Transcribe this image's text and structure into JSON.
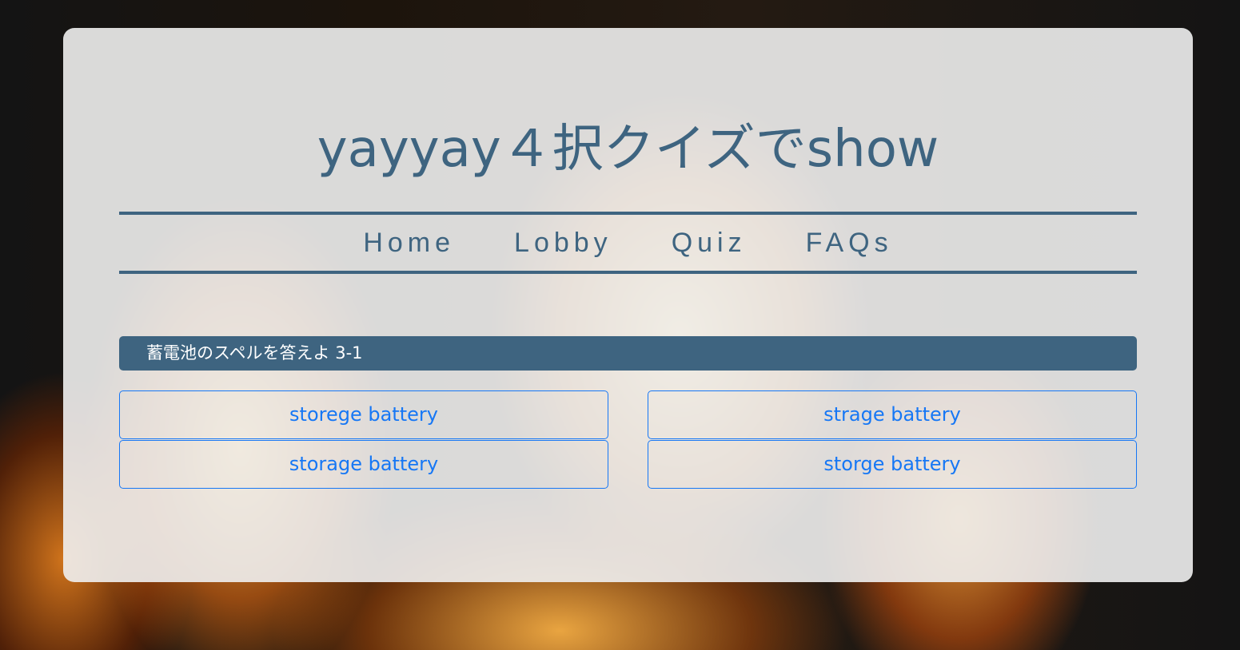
{
  "page": {
    "title": "yayyay４択クイズでshow"
  },
  "nav": {
    "items": [
      {
        "label": "Home"
      },
      {
        "label": "Lobby"
      },
      {
        "label": "Quiz"
      },
      {
        "label": "FAQs"
      }
    ]
  },
  "quiz": {
    "question": "蓄電池のスペルを答えよ 3-1",
    "answers": [
      {
        "label": "storege battery"
      },
      {
        "label": "strage battery"
      },
      {
        "label": "storage battery"
      },
      {
        "label": "storge battery"
      }
    ]
  },
  "colors": {
    "primary": "#3e6480",
    "answer_border": "#1677f5",
    "card_bg": "#f0f0f0"
  }
}
